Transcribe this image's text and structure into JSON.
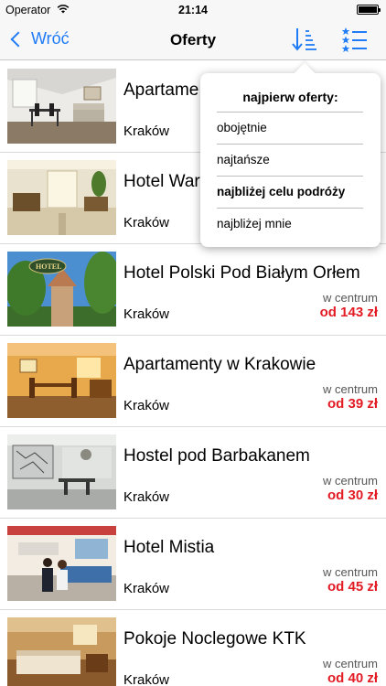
{
  "status": {
    "carrier": "Operator",
    "time": "21:14"
  },
  "nav": {
    "back_label": "Wróć",
    "title": "Oferty"
  },
  "sort_menu": {
    "header": "najpierw oferty:",
    "options": [
      "obojętnie",
      "najtańsze",
      "najbliżej celu podróży",
      "najbliżej mnie"
    ],
    "selected": "najbliżej celu podróży"
  },
  "offers": [
    {
      "name": "Apartame",
      "city": "Kraków",
      "location": "",
      "price": ""
    },
    {
      "name": "Hotel War",
      "city": "Kraków",
      "location": "",
      "price": ""
    },
    {
      "name": "Hotel Polski Pod Białym Orłem",
      "city": "Kraków",
      "location": "w centrum",
      "price": "od 143 zł"
    },
    {
      "name": "Apartamenty w Krakowie",
      "city": "Kraków",
      "location": "w centrum",
      "price": "od 39 zł"
    },
    {
      "name": "Hostel pod Barbakanem",
      "city": "Kraków",
      "location": "w centrum",
      "price": "od 30 zł"
    },
    {
      "name": "Hotel Mistia",
      "city": "Kraków",
      "location": "w centrum",
      "price": "od 45 zł"
    },
    {
      "name": "Pokoje Noclegowe KTK",
      "city": "Kraków",
      "location": "w centrum",
      "price": "od 40 zł"
    }
  ],
  "colors": {
    "accent": "#1f7cf6",
    "price": "#e31b23"
  },
  "icons": [
    "back-chevron-icon",
    "sort-order-icon",
    "filter-list-icon",
    "wifi-icon",
    "battery-icon"
  ]
}
